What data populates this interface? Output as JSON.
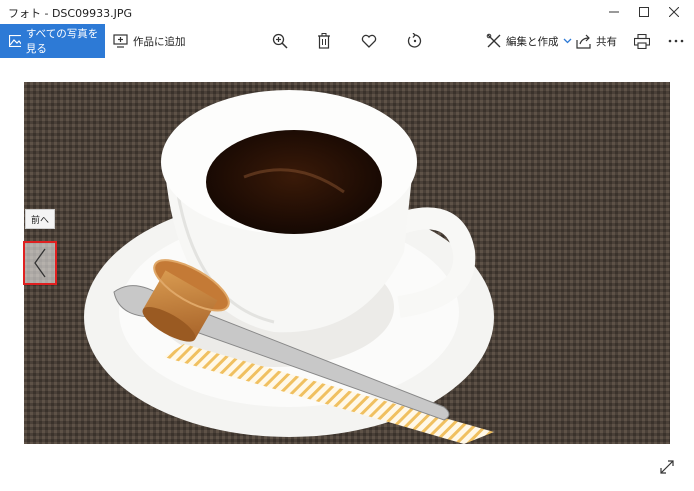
{
  "window": {
    "title": "フォト - DSC09933.JPG"
  },
  "toolbar": {
    "all_photos_label": "すべての写真を見る",
    "add_to_creation_label": "作品に追加",
    "edit_create_label": "編集と作成",
    "share_label": "共有",
    "icons": [
      "zoom-in-icon",
      "delete-icon",
      "favorite-icon",
      "rotate-icon",
      "edit-create-icon",
      "share-icon",
      "print-icon",
      "more-icon"
    ]
  },
  "viewer": {
    "prev_tooltip": "前へ"
  },
  "colors": {
    "accent": "#2d7ad6",
    "highlight_border": "#e02020"
  }
}
